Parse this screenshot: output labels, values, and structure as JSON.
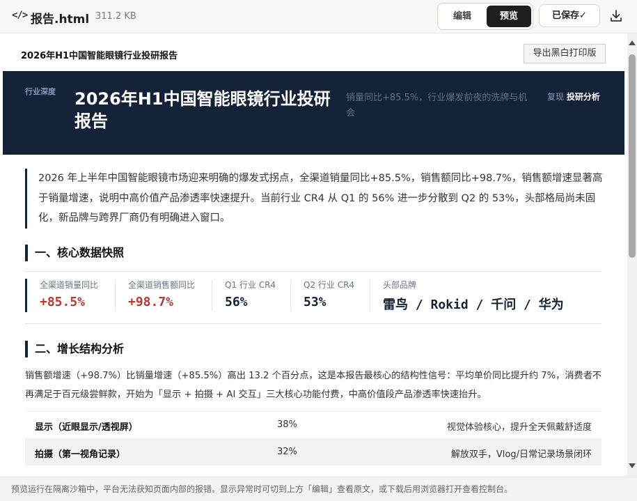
{
  "topbar": {
    "file_icon": "</>",
    "file_name": "报告.html",
    "file_size": "311.2 KB",
    "edit_label": "编辑",
    "preview_label": "预览",
    "saved_label": "已保存✓",
    "download_icon": "download-icon"
  },
  "doc": {
    "title": "2026年H1中国智能眼镜行业投研报告",
    "print_label": "导出黑白打印版"
  },
  "hero": {
    "tag": "行业深度",
    "title": "2026年H1中国智能眼镜行业投研报告",
    "subtitle": "销量同比+85.5%，行业爆发前夜的洗牌与机会",
    "nav_secondary": "复现",
    "nav_primary": "投研分析"
  },
  "intro": "2026 年上半年中国智能眼镜市场迎来明确的爆发式拐点，全渠道销量同比+85.5%，销售额同比+98.7%，销售额增速显著高于销量增速，说明中高价值产品渗透率快速提升。当前行业 CR4 从 Q1 的 56% 进一步分散到 Q2 的 53%，头部格局尚未固化，新品牌与跨界厂商仍有明确进入窗口。",
  "section1": {
    "title": "一、核心数据快照"
  },
  "metrics": [
    {
      "label": "全渠道销量同比",
      "value": "+85.5%"
    },
    {
      "label": "全渠道销售额同比",
      "value": "+98.7%"
    },
    {
      "label": "Q1 行业 CR4",
      "value": "56%"
    },
    {
      "label": "Q2 行业 CR4",
      "value": "53%"
    },
    {
      "label": "头部品牌",
      "value": "雷鸟 / Rokid / 千问 / 华为"
    }
  ],
  "section2": {
    "title": "二、增长结构分析",
    "body": "销售额增速（+98.7%）比销量增速（+85.5%）高出 13.2 个百分点，这是本报告最核心的结构性信号：平均单价同比提升约 7%，消费者不再满足于百元级尝鲜款，开始为「显示 + 拍摄 + AI 交互」三大核心功能付费，中高价值段产品渗透率快速抬升。"
  },
  "table": {
    "rows": [
      {
        "feature": "显示（近眼显示/透视屏）",
        "share": "38%",
        "note": "视觉体验核心，提升全天佩戴舒适度"
      },
      {
        "feature": "拍摄（第一视角记录）",
        "share": "32%",
        "note": "解放双手，Vlog/日常记录场景闭环"
      }
    ]
  },
  "footer": {
    "text": "预览运行在隔离沙箱中，平台无法获知页面内部的报错。显示异常时可切到上方「编辑」查看原文，或下载后用浏览器打开查看控制台。"
  },
  "colors": {
    "hero_bg": "#132237",
    "accent_red": "#b9382f",
    "accent_navy": "#132237"
  }
}
